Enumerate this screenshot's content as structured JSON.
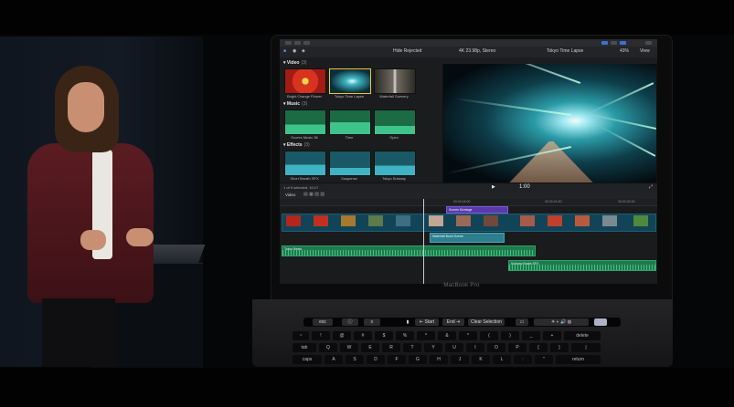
{
  "scene": {
    "presenter": "presenter",
    "device_brand": "MacBook Pro"
  },
  "app": {
    "toolbar": {
      "filter_label": "Hide Rejected",
      "library_label": "4K 23.98p, Stereo",
      "viewer_clip": "Tokyo Time Lapse",
      "zoom": "43%",
      "view_label": "View"
    },
    "browser": {
      "sections": [
        {
          "title": "Video",
          "count": "(3)"
        },
        {
          "title": "Music",
          "count": "(3)"
        },
        {
          "title": "Effects",
          "count": "(3)"
        }
      ],
      "video_clips": [
        "Bright Orange Flower",
        "Tokyo Time Lapse",
        "Waterfall Scenery"
      ],
      "music_clips": [
        "Scores Music 36",
        "Time",
        "Open"
      ],
      "effects_clips": [
        "Short Breath SFX",
        "Suspense",
        "Tokyo Subway"
      ],
      "status": "1 of 9 selected, 10:17"
    },
    "viewer": {
      "timecode": "1:00"
    },
    "timeline": {
      "index_label": "Video",
      "title_clip": "Scores Montage",
      "connected_clip": "Waterfall Burst Scene",
      "audio_clip_1": "Tokyo Beats",
      "audio_clip_2": "Subway Brake SFX",
      "ruler_marks": [
        "00:00:18:00",
        "00:00:24:00",
        "00:00:30:00"
      ]
    }
  },
  "touch_bar": {
    "esc": "esc",
    "start": "Start",
    "end": "End",
    "clear": "Clear Selection"
  },
  "keyboard": {
    "row1": [
      "~",
      "!",
      "@",
      "#",
      "$",
      "%",
      "^",
      "&",
      "*",
      "(",
      ")",
      "_",
      "+",
      "delete"
    ],
    "row2": [
      "tab",
      "Q",
      "W",
      "E",
      "R",
      "T",
      "Y",
      "U",
      "I",
      "O",
      "P",
      "{",
      "}",
      "|"
    ],
    "row3": [
      "caps",
      "A",
      "S",
      "D",
      "F",
      "G",
      "H",
      "J",
      "K",
      "L",
      ":",
      "\"",
      "return"
    ]
  },
  "colors": {
    "accent_blue": "#3b6fd8",
    "selection_yellow": "#f2c230",
    "audio_green": "#1f7a4c",
    "video_blue": "#124457",
    "title_purple": "#5a3aa8"
  }
}
